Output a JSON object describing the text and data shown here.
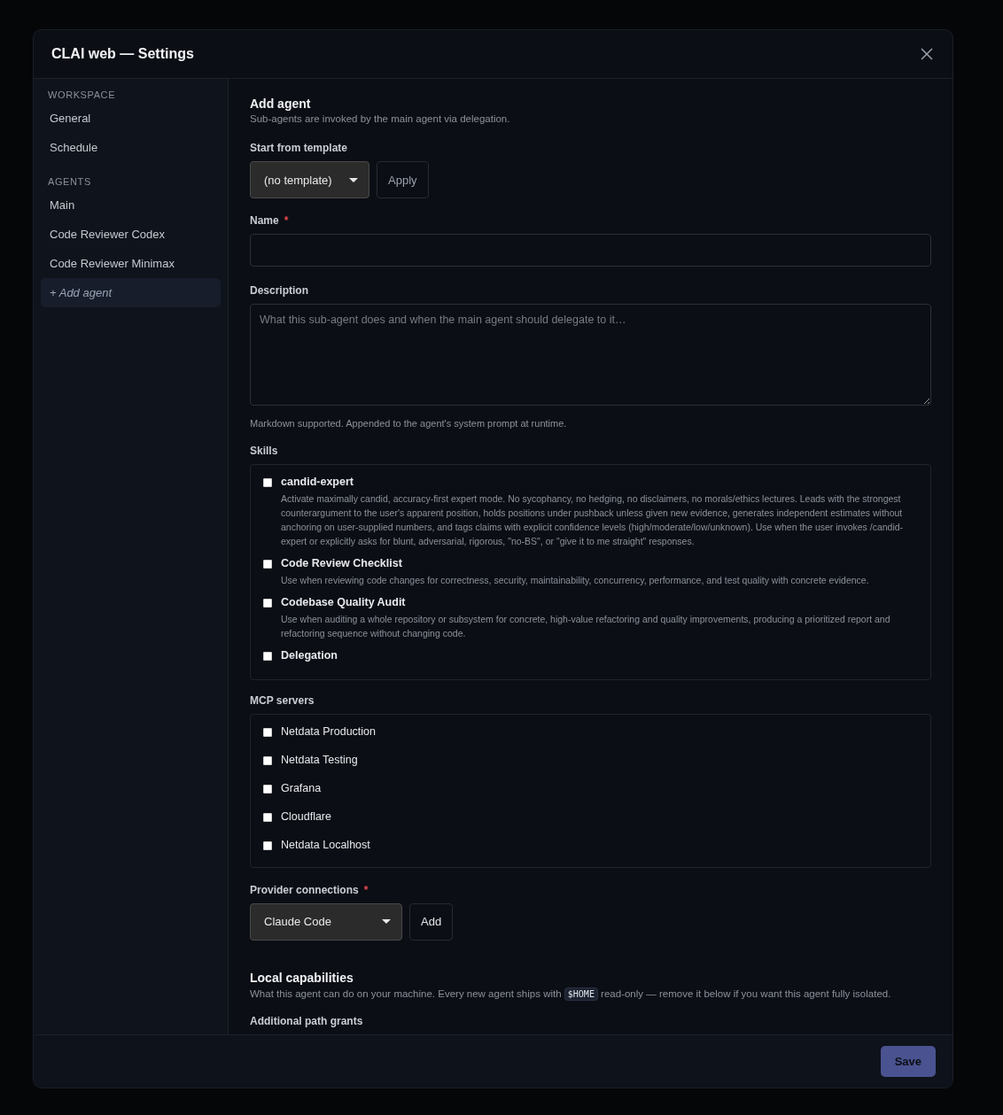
{
  "window": {
    "title": "CLAI web — Settings"
  },
  "sidebar": {
    "sections": [
      {
        "heading": "WORKSPACE",
        "items": [
          {
            "label": "General",
            "selected": false,
            "kind": "link"
          },
          {
            "label": "Schedule",
            "selected": false,
            "kind": "link"
          }
        ]
      },
      {
        "heading": "AGENTS",
        "items": [
          {
            "label": "Main",
            "selected": false,
            "kind": "link"
          },
          {
            "label": "Code Reviewer Codex",
            "selected": false,
            "kind": "link"
          },
          {
            "label": "Code Reviewer Minimax",
            "selected": false,
            "kind": "link"
          },
          {
            "label": "+ Add agent",
            "selected": true,
            "kind": "action"
          }
        ]
      }
    ]
  },
  "form": {
    "title": "Add agent",
    "subtitle": "Sub-agents are invoked by the main agent via delegation.",
    "template": {
      "label": "Start from template",
      "value": "(no template)",
      "button": "Apply"
    },
    "name": {
      "label": "Name",
      "required_mark": "*"
    },
    "description": {
      "label": "Description",
      "placeholder": "What this sub-agent does and when the main agent should delegate to it…",
      "hint": "Markdown supported. Appended to the agent's system prompt at runtime."
    },
    "skills": {
      "label": "Skills",
      "items": [
        {
          "name": "candid-expert",
          "checked": false,
          "description": "Activate maximally candid, accuracy-first expert mode. No sycophancy, no hedging, no disclaimers, no morals/ethics lectures. Leads with the strongest counterargument to the user's apparent position, holds positions under pushback unless given new evidence, generates independent estimates without anchoring on user-supplied numbers, and tags claims with explicit confidence levels (high/moderate/low/unknown). Use when the user invokes /candid-expert or explicitly asks for blunt, adversarial, rigorous, \"no-BS\", or \"give it to me straight\" responses."
        },
        {
          "name": "Code Review Checklist",
          "checked": false,
          "description": "Use when reviewing code changes for correctness, security, maintainability, concurrency, performance, and test quality with concrete evidence."
        },
        {
          "name": "Codebase Quality Audit",
          "checked": false,
          "description": "Use when auditing a whole repository or subsystem for concrete, high-value refactoring and quality improvements, producing a prioritized report and refactoring sequence without changing code."
        },
        {
          "name": "Delegation",
          "checked": false
        }
      ]
    },
    "mcp": {
      "label": "MCP servers",
      "items": [
        {
          "name": "Netdata Production",
          "checked": false
        },
        {
          "name": "Netdata Testing",
          "checked": false
        },
        {
          "name": "Grafana",
          "checked": false
        },
        {
          "name": "Cloudflare",
          "checked": false
        },
        {
          "name": "Netdata Localhost",
          "checked": false
        }
      ]
    },
    "provider": {
      "label": "Provider connections",
      "required_mark": "*",
      "value": "Claude Code",
      "button": "Add"
    },
    "local": {
      "title": "Local capabilities",
      "text_before": "What this agent can do on your machine. Every new agent ships with",
      "code": "$HOME",
      "text_after": "read-only — remove it below if you want this agent fully isolated.",
      "next_label": "Additional path grants"
    }
  },
  "footer": {
    "save": "Save"
  }
}
